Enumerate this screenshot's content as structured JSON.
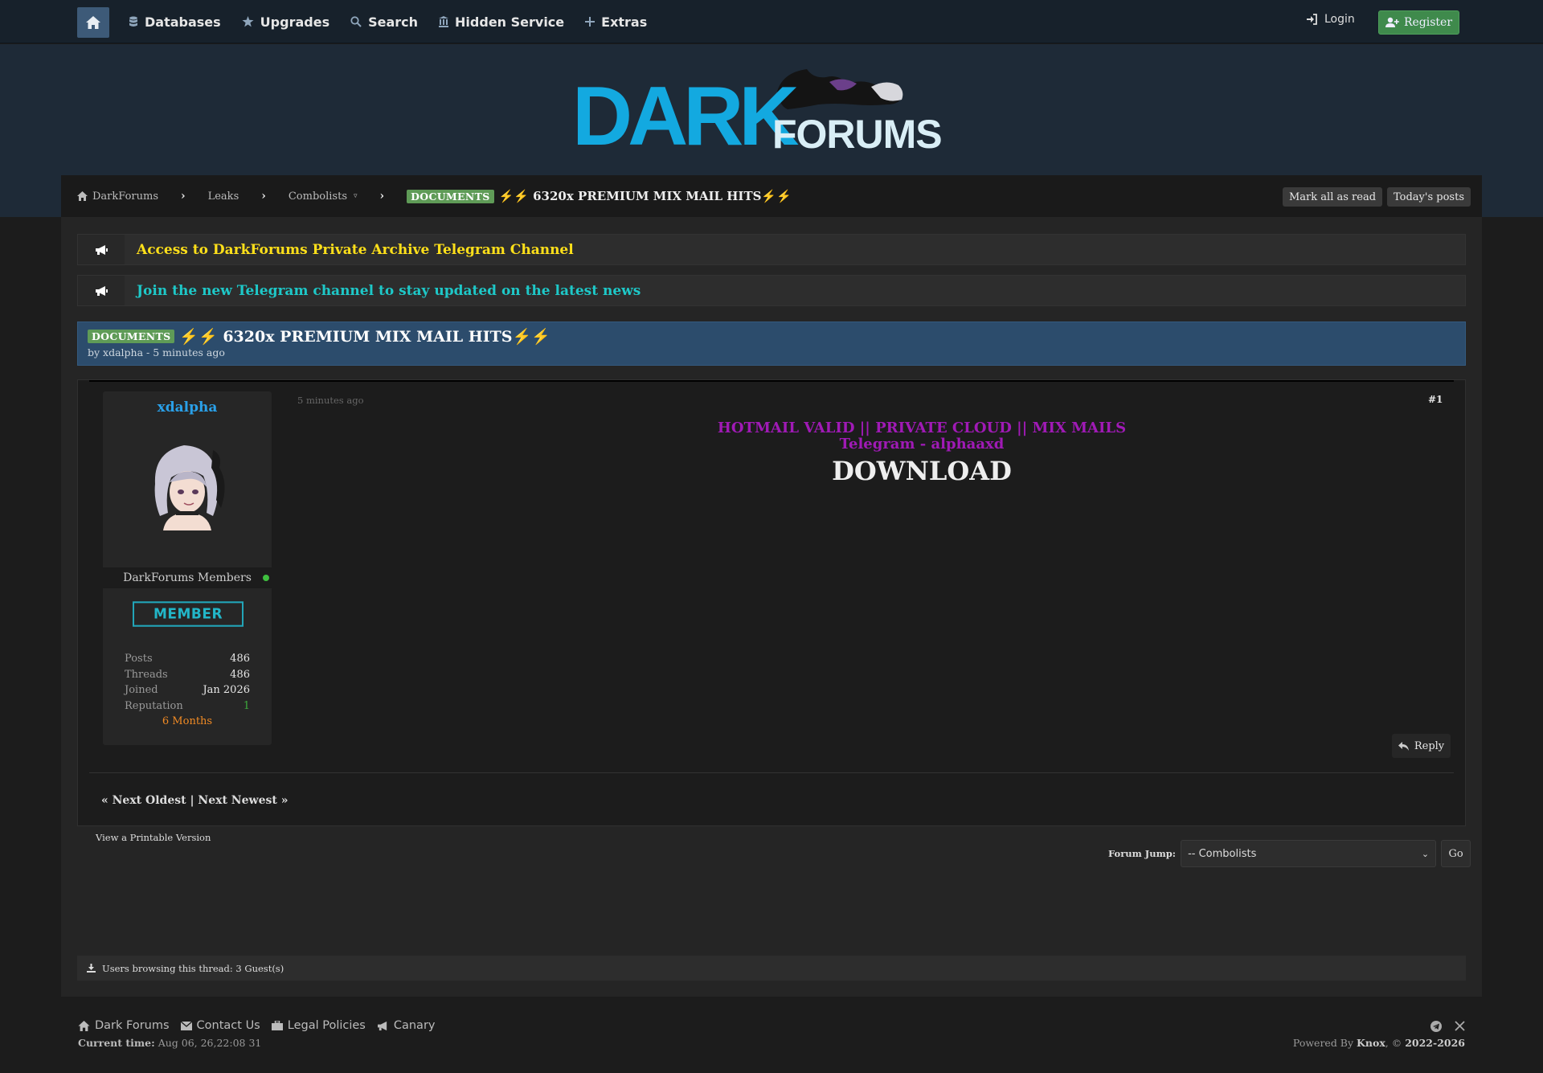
{
  "nav": {
    "items": [
      {
        "label": "Databases",
        "icon": "database-icon"
      },
      {
        "label": "Upgrades",
        "icon": "star-icon"
      },
      {
        "label": "Search",
        "icon": "search-icon"
      },
      {
        "label": "Hidden Service",
        "icon": "building-icon"
      },
      {
        "label": "Extras",
        "icon": "plus-icon"
      }
    ],
    "login": "Login",
    "register": "Register"
  },
  "logo": {
    "text_main": "DARK",
    "text_sub": "FORUMS"
  },
  "breadcrumb": {
    "items": [
      "DarkForums",
      "Leaks",
      "Combolists"
    ],
    "tag": "DOCUMENTS",
    "title": "⚡⚡ 6320x PREMIUM MIX MAIL HITS⚡⚡",
    "mark_read": "Mark all as read",
    "todays_posts": "Today's posts"
  },
  "announcements": [
    {
      "text": "Access to DarkForums Private Archive Telegram Channel",
      "color": "#ffe01a"
    },
    {
      "text": "Join the new Telegram channel to stay updated on the latest news",
      "color": "#1ec8c8"
    }
  ],
  "thread": {
    "tag": "DOCUMENTS",
    "title": "⚡⚡ 6320x PREMIUM MIX MAIL HITS⚡⚡",
    "byline": "by xdalpha - 5 minutes ago"
  },
  "post": {
    "username": "xdalpha",
    "group": "DarkForums Members",
    "badge": "MEMBER",
    "stats": [
      {
        "key": "Posts",
        "value": "486"
      },
      {
        "key": "Threads",
        "value": "486"
      },
      {
        "key": "Joined",
        "value": "Jan 2026"
      },
      {
        "key": "Reputation",
        "value": "1"
      }
    ],
    "membership": "6 Months",
    "time": "5 minutes ago",
    "number": "#1",
    "line1": "HOTMAIL VALID || PRIVATE CLOUD || MIX MAILS",
    "line2": "Telegram - alphaaxd",
    "line3": "DOWNLOAD",
    "reply": "Reply"
  },
  "pager": "« Next Oldest | Next Newest »",
  "printable": "View a Printable Version",
  "forum_jump": {
    "label": "Forum Jump:",
    "selected": "-- Combolists",
    "go": "Go"
  },
  "browsing": "Users browsing this thread: 3 Guest(s)",
  "footer": {
    "links": [
      {
        "label": "Dark Forums",
        "icon": "home-icon"
      },
      {
        "label": "Contact Us",
        "icon": "envelope-icon"
      },
      {
        "label": "Legal Policies",
        "icon": "briefcase-icon"
      },
      {
        "label": "Canary",
        "icon": "megaphone-icon"
      }
    ],
    "current_time_label": "Current time:",
    "current_time": "Aug 06, 26,22:08 31",
    "powered_prefix": "Powered By",
    "powered_name": "Knox",
    "copyright_sep": ", ©",
    "years": "2022-2026"
  }
}
